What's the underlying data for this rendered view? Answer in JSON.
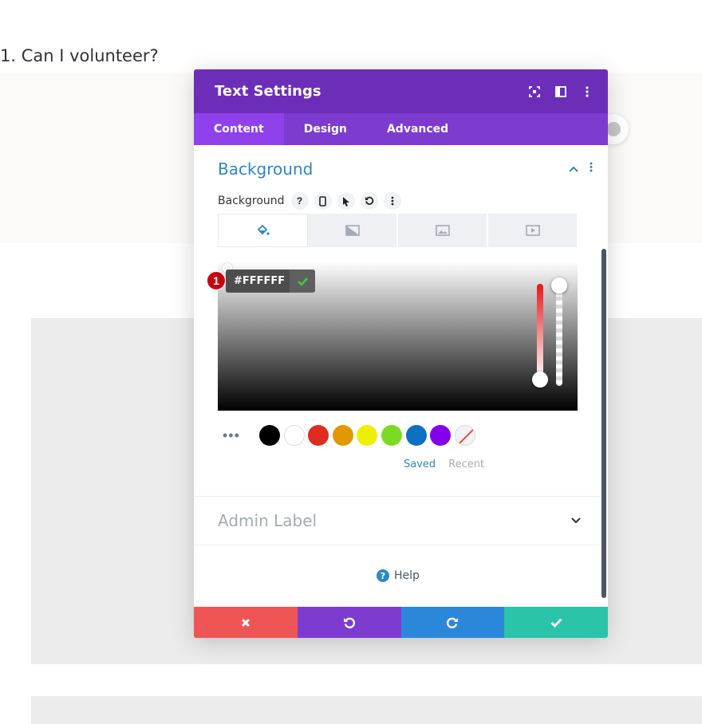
{
  "page": {
    "question": "1. Can I volunteer?"
  },
  "modal": {
    "title": "Text Settings",
    "tabs": [
      {
        "label": "Content",
        "active": true
      },
      {
        "label": "Design",
        "active": false
      },
      {
        "label": "Advanced",
        "active": false
      }
    ],
    "section_title": "Background",
    "background_label": "Background",
    "color_picker": {
      "hex_value": "#FFFFFF",
      "callout_number": "1",
      "swatches": [
        "#000000",
        "#ffffff",
        "#e02b20",
        "#e09900",
        "#edf000",
        "#7cda24",
        "#0c71c3",
        "#8300e9"
      ],
      "saved_label": "Saved",
      "recent_label": "Recent"
    },
    "admin_label": "Admin Label",
    "help_label": "Help",
    "colors": {
      "header": "#6c2eb9",
      "tabs": "#7e3bd0",
      "accent": "#2e87c4",
      "cancel": "#ef5555",
      "undo": "#7e3bd0",
      "redo": "#2b87da",
      "save": "#29c4a9"
    }
  }
}
